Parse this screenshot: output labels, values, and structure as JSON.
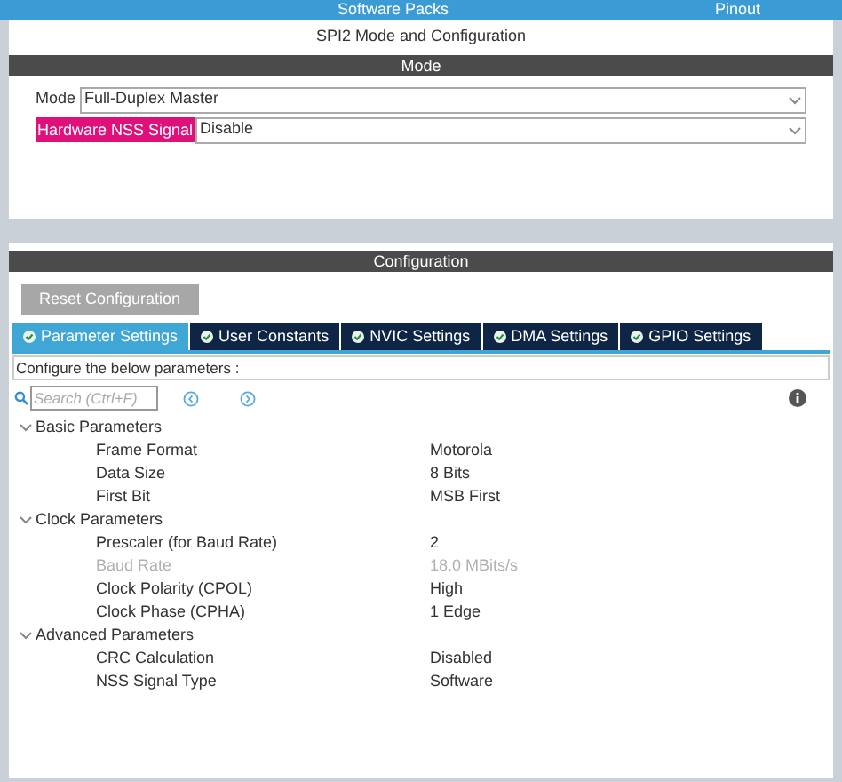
{
  "top_bar": {
    "items": [
      "Software Packs",
      "Pinout"
    ]
  },
  "title": "SPI2 Mode and Configuration",
  "mode_section": {
    "header": "Mode",
    "fields": [
      {
        "label": "Mode",
        "value": "Full-Duplex Master",
        "highlighted": false
      },
      {
        "label": "Hardware NSS Signal",
        "value": "Disable",
        "highlighted": true
      }
    ]
  },
  "configuration_section": {
    "header": "Configuration",
    "reset_button": "Reset Configuration",
    "tabs": [
      {
        "label": "Parameter Settings",
        "selected": true
      },
      {
        "label": "User Constants",
        "selected": false
      },
      {
        "label": "NVIC Settings",
        "selected": false
      },
      {
        "label": "DMA Settings",
        "selected": false
      },
      {
        "label": "GPIO Settings",
        "selected": false
      }
    ],
    "hint": "Configure the below parameters :",
    "search": {
      "placeholder": "Search (Ctrl+F)"
    },
    "tree": [
      {
        "label": "Basic Parameters",
        "expanded": true,
        "children": [
          {
            "label": "Frame Format",
            "value": "Motorola",
            "disabled": false
          },
          {
            "label": "Data Size",
            "value": "8 Bits",
            "disabled": false
          },
          {
            "label": "First Bit",
            "value": "MSB First",
            "disabled": false
          }
        ]
      },
      {
        "label": "Clock Parameters",
        "expanded": true,
        "children": [
          {
            "label": "Prescaler (for Baud Rate)",
            "value": "2",
            "disabled": false
          },
          {
            "label": "Baud Rate",
            "value": "18.0 MBits/s",
            "disabled": true
          },
          {
            "label": "Clock Polarity (CPOL)",
            "value": "High",
            "disabled": false
          },
          {
            "label": "Clock Phase (CPHA)",
            "value": "1 Edge",
            "disabled": false
          }
        ]
      },
      {
        "label": "Advanced Parameters",
        "expanded": true,
        "children": [
          {
            "label": "CRC Calculation",
            "value": "Disabled",
            "disabled": false
          },
          {
            "label": "NSS Signal Type",
            "value": "Software",
            "disabled": false
          }
        ]
      }
    ]
  }
}
